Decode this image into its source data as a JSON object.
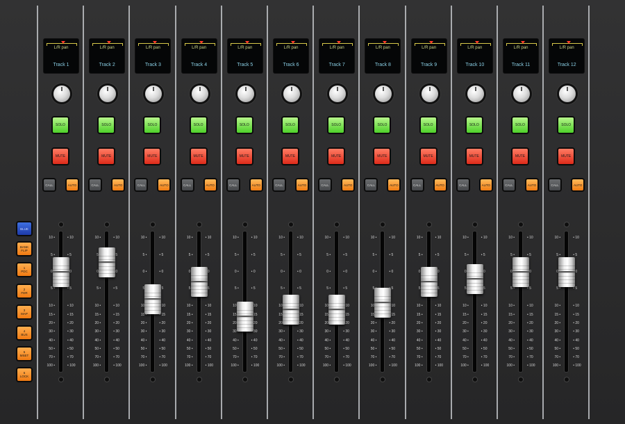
{
  "side_buttons": [
    {
      "key": "blue",
      "top": "BLUE",
      "bottom": "",
      "color": "#2b4fcb"
    },
    {
      "key": "bank",
      "top": "BANK",
      "bottom": "FLIP",
      "color": "#f28a1c"
    },
    {
      "key": "pdc",
      "top": "1",
      "bottom": "PDC",
      "color": "#f28a1c"
    },
    {
      "key": "fdr",
      "top": "2",
      "bottom": "FDR",
      "color": "#f28a1c"
    },
    {
      "key": "map",
      "top": "3",
      "bottom": "MAP",
      "color": "#f28a1c"
    },
    {
      "key": "bus",
      "top": "4",
      "bottom": "BUS",
      "color": "#f28a1c"
    },
    {
      "key": "mset",
      "top": "5",
      "bottom": "MSET",
      "color": "#f28a1c"
    },
    {
      "key": "lock",
      "top": "6",
      "bottom": "LOCK",
      "color": "#f28a1c"
    }
  ],
  "strip_labels": {
    "pan": "L/R pan",
    "solo": "SOLO",
    "mute": "MUTE",
    "call": "CALL",
    "auto": "AUTO"
  },
  "fader_scale": [
    "10",
    "5",
    "0",
    "5",
    "10",
    "15",
    "20",
    "30",
    "40",
    "50",
    "70",
    "100"
  ],
  "tracks": [
    {
      "name": "Track 1",
      "fader_level_db": 0
    },
    {
      "name": "Track 2",
      "fader_level_db": 3
    },
    {
      "name": "Track 3",
      "fader_level_db": -8
    },
    {
      "name": "Track 4",
      "fader_level_db": -3
    },
    {
      "name": "Track 5",
      "fader_level_db": -16
    },
    {
      "name": "Track 6",
      "fader_level_db": -12
    },
    {
      "name": "Track 7",
      "fader_level_db": -12
    },
    {
      "name": "Track 8",
      "fader_level_db": -9
    },
    {
      "name": "Track 9",
      "fader_level_db": -3
    },
    {
      "name": "Track 10",
      "fader_level_db": -2
    },
    {
      "name": "Track 11",
      "fader_level_db": 0
    },
    {
      "name": "Track 12",
      "fader_level_db": 0
    }
  ],
  "colors": {
    "solo": "#4ed12a",
    "mute": "#de2b1a",
    "auto": "#f07d14",
    "lcd_text": "#8bd0e6"
  }
}
